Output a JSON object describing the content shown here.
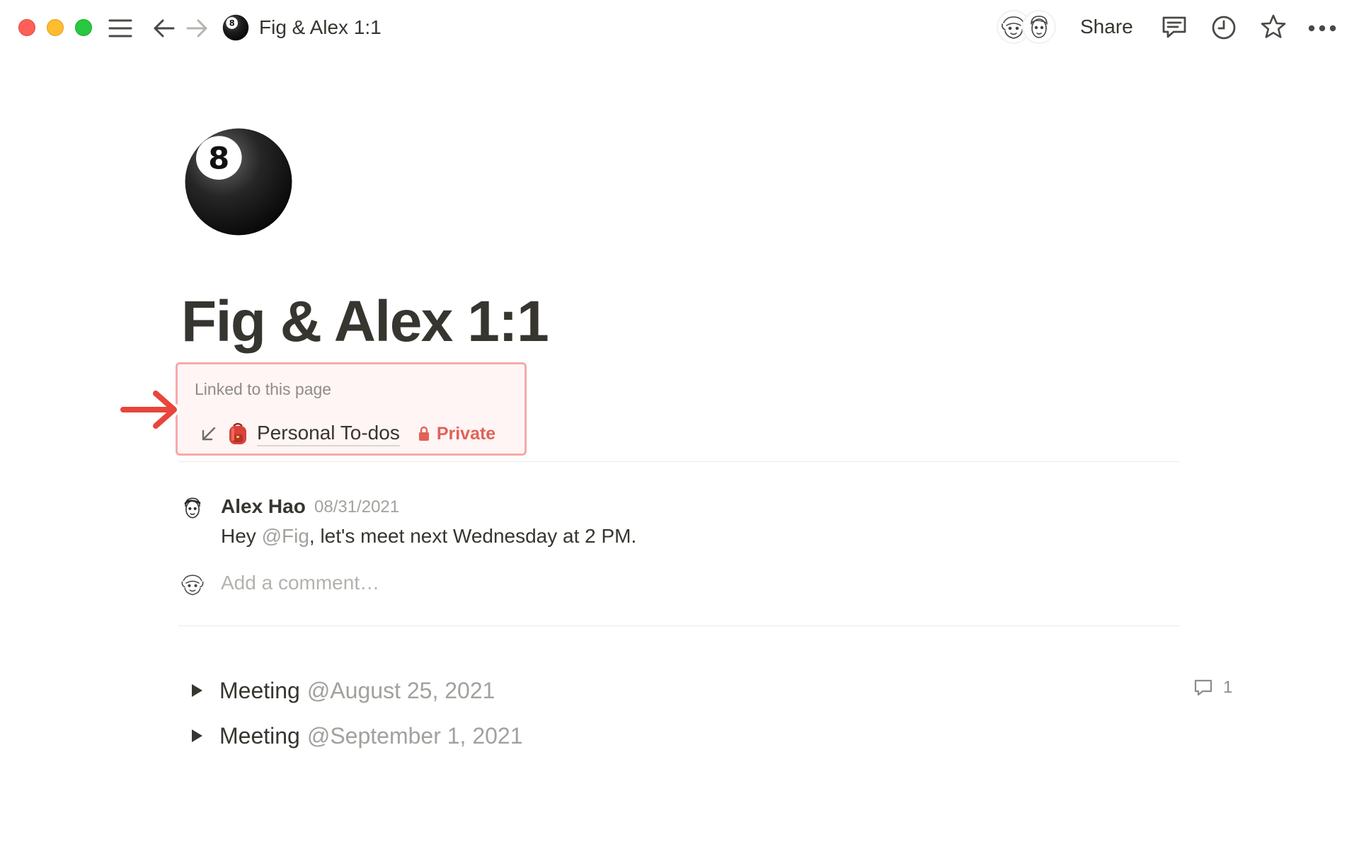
{
  "window": {
    "title": "Fig & Alex 1:1"
  },
  "topbar": {
    "breadcrumb_title": "Fig & Alex 1:1",
    "share_label": "Share",
    "icons": [
      "menu-icon",
      "back-arrow-icon",
      "forward-arrow-icon",
      "eight-ball-icon",
      "comments-icon",
      "history-clock-icon",
      "favorite-star-icon",
      "more-dots-icon"
    ]
  },
  "page": {
    "title": "Fig & Alex 1:1",
    "icon": "eight-ball-icon"
  },
  "linked": {
    "label": "Linked to this page",
    "page_name": "Personal To-dos",
    "page_icon": "backpack-icon",
    "private_label": "Private"
  },
  "comment": {
    "author": "Alex Hao",
    "date": "08/31/2021",
    "text_before": "Hey ",
    "mention": "@Fig",
    "text_after": ", let's meet next Wednesday at 2 PM.",
    "add_placeholder": "Add a comment…"
  },
  "toggles": [
    {
      "label": "Meeting",
      "date": "@August 25, 2021"
    },
    {
      "label": "Meeting",
      "date": "@September 1, 2021"
    }
  ],
  "comment_count": "1",
  "colors": {
    "accent_red": "#e16259",
    "highlight_border": "#f4aaa9",
    "text": "#37352f",
    "muted": "#a3a19d"
  }
}
